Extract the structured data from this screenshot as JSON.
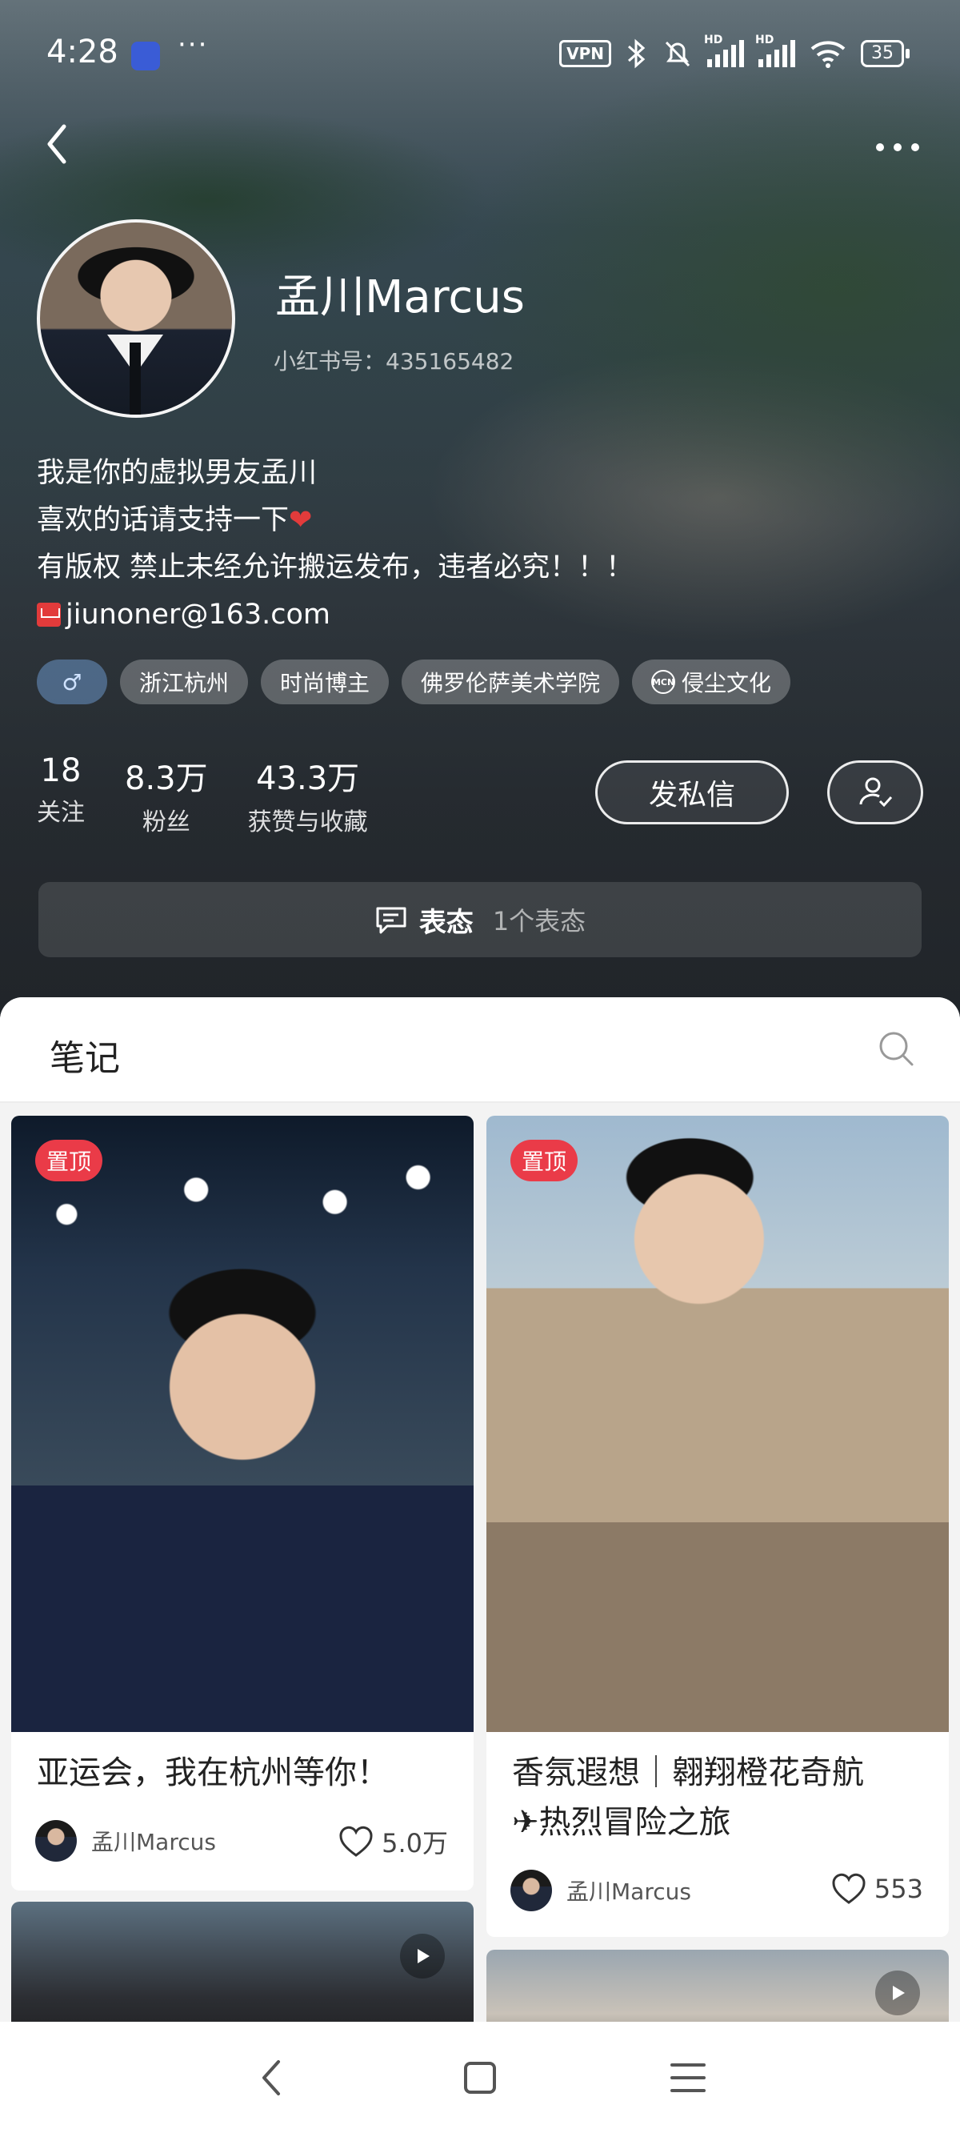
{
  "status_bar": {
    "time": "4:28",
    "more": "···",
    "vpn": "VPN",
    "hd1": "HD",
    "hd2": "HD",
    "battery": "35"
  },
  "profile": {
    "name": "孟川Marcus",
    "red_id": "小红书号：435165482",
    "bio_lines": [
      "我是你的虚拟男友孟川",
      "喜欢的话请支持一下",
      "有版权 禁止未经允许搬运发布，违者必究！！！",
      "jiunoner@163.com"
    ],
    "bio_heart": "❤",
    "gender_symbol": "♂",
    "tags": [
      "浙江杭州",
      "时尚博主",
      "佛罗伦萨美术学院",
      "侵尘文化"
    ],
    "mcn_label": "MCN"
  },
  "stats": [
    {
      "num": "18",
      "label": "关注"
    },
    {
      "num": "8.3万",
      "label": "粉丝"
    },
    {
      "num": "43.3万",
      "label": "获赞与收藏"
    }
  ],
  "actions": {
    "message": "发私信"
  },
  "status_post": {
    "title": "表态",
    "count": "1个表态"
  },
  "notes": {
    "tab_title": "笔记",
    "pin_label": "置顶",
    "cards": [
      {
        "title": "亚运会，我在杭州等你！",
        "author": "孟川Marcus",
        "likes": "5.0万"
      },
      {
        "title_line1": "香氛遐想｜翱翔橙花奇航",
        "title_line2": "✈热烈冒险之旅",
        "author": "孟川Marcus",
        "likes": "553"
      }
    ]
  },
  "icons": {
    "back": "chevron-left-icon",
    "more": "more-horizontal-icon",
    "search": "search-icon",
    "like": "heart-icon",
    "follow": "user-check-icon",
    "comment": "chat-bubble-icon",
    "play": "play-icon"
  }
}
